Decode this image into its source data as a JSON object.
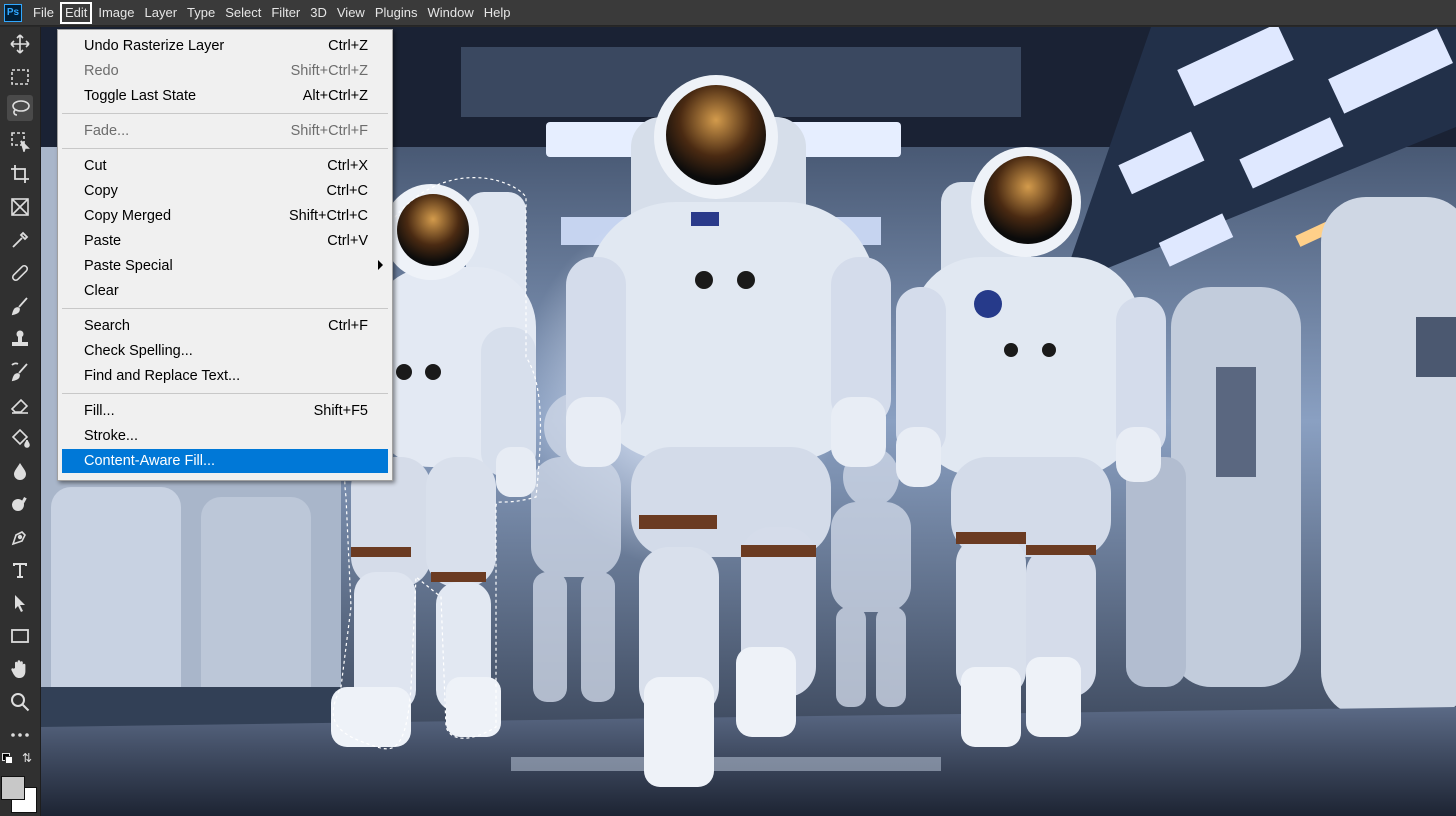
{
  "app": {
    "logo_text": "Ps"
  },
  "menubar": {
    "items": [
      {
        "label": "File"
      },
      {
        "label": "Edit",
        "active": true
      },
      {
        "label": "Image"
      },
      {
        "label": "Layer"
      },
      {
        "label": "Type"
      },
      {
        "label": "Select"
      },
      {
        "label": "Filter"
      },
      {
        "label": "3D"
      },
      {
        "label": "View"
      },
      {
        "label": "Plugins"
      },
      {
        "label": "Window"
      },
      {
        "label": "Help"
      }
    ]
  },
  "edit_menu": {
    "items": [
      {
        "label": "Undo Rasterize Layer",
        "shortcut": "Ctrl+Z"
      },
      {
        "label": "Redo",
        "shortcut": "Shift+Ctrl+Z",
        "disabled": true
      },
      {
        "label": "Toggle Last State",
        "shortcut": "Alt+Ctrl+Z"
      },
      {
        "label": "Fade...",
        "shortcut": "Shift+Ctrl+F",
        "disabled": true
      },
      {
        "label": "Cut",
        "shortcut": "Ctrl+X"
      },
      {
        "label": "Copy",
        "shortcut": "Ctrl+C"
      },
      {
        "label": "Copy Merged",
        "shortcut": "Shift+Ctrl+C"
      },
      {
        "label": "Paste",
        "shortcut": "Ctrl+V"
      },
      {
        "label": "Paste Special",
        "shortcut": "",
        "submenu": true
      },
      {
        "label": "Clear",
        "shortcut": ""
      },
      {
        "label": "Search",
        "shortcut": "Ctrl+F"
      },
      {
        "label": "Check Spelling...",
        "shortcut": ""
      },
      {
        "label": "Find and Replace Text...",
        "shortcut": ""
      },
      {
        "label": "Fill...",
        "shortcut": "Shift+F5"
      },
      {
        "label": "Stroke...",
        "shortcut": ""
      },
      {
        "label": "Content-Aware Fill...",
        "shortcut": "",
        "highlighted": true
      }
    ]
  },
  "tools": [
    "move-tool-icon",
    "marquee-tool-icon",
    "lasso-tool-icon",
    "object-selection-tool-icon",
    "crop-tool-icon",
    "frame-tool-icon",
    "eyedropper-tool-icon",
    "healing-brush-tool-icon",
    "brush-tool-icon",
    "clone-stamp-tool-icon",
    "history-brush-tool-icon",
    "eraser-tool-icon",
    "paint-bucket-tool-icon",
    "blur-tool-icon",
    "dodge-tool-icon",
    "pen-tool-icon",
    "type-tool-icon",
    "path-selection-tool-icon",
    "rectangle-tool-icon",
    "hand-tool-icon",
    "zoom-tool-icon",
    "more-tools-icon"
  ],
  "colors": {
    "foreground": "#c8c8c8",
    "background": "#ffffff",
    "menu_highlight": "#0078d7"
  }
}
